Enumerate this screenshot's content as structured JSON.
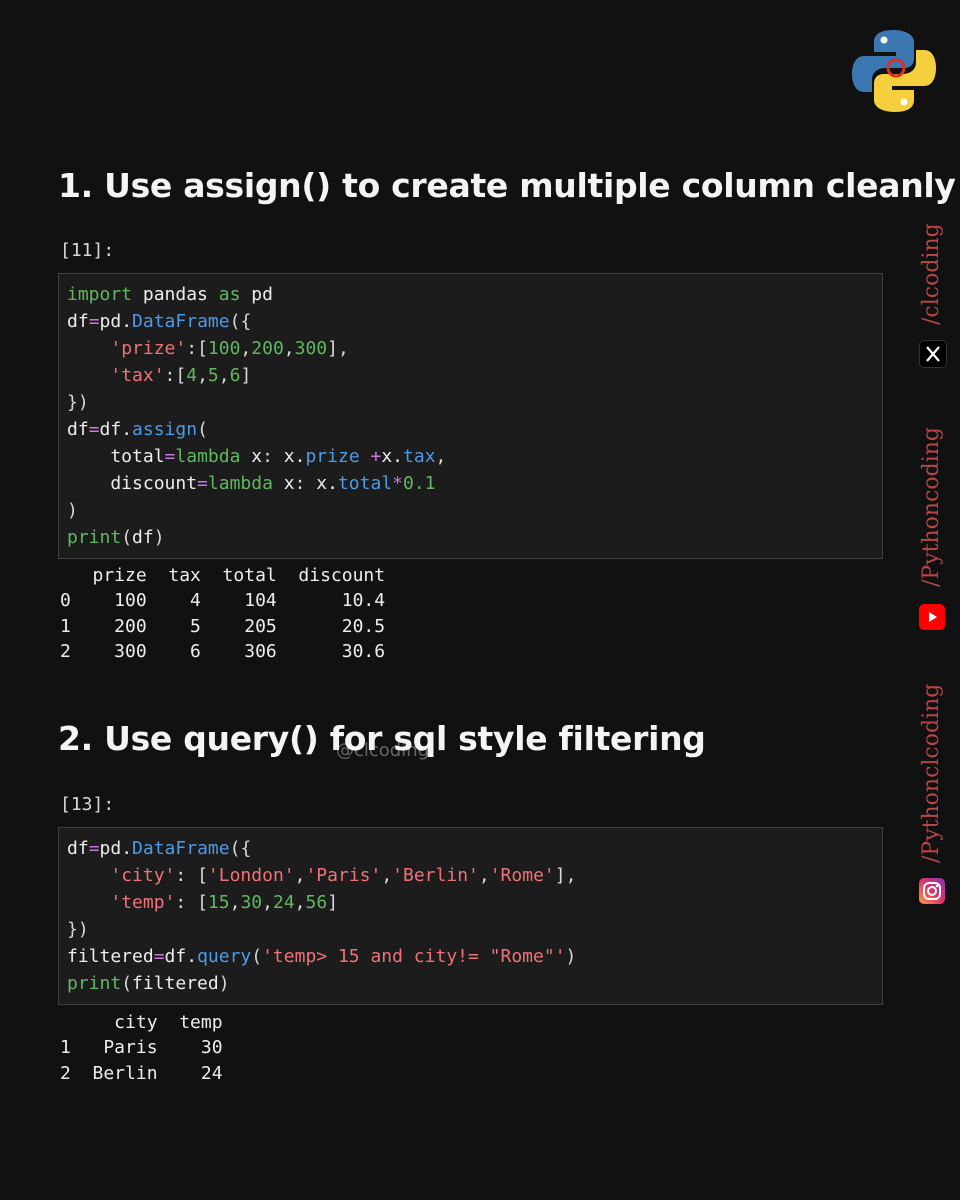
{
  "brand": {
    "logo": "python-logo-icon",
    "watermark": "@clcoding"
  },
  "sections": [
    {
      "heading": "1. Use assign() to create multiple column cleanly",
      "prompt": "[11]:",
      "code_lines": [
        "import pandas as pd",
        "df=pd.DataFrame({",
        "    'prize':[100,200,300],",
        "    'tax':[4,5,6]",
        "})",
        "df=df.assign(",
        "    total=lambda x: x.prize +x.tax,",
        "    discount=lambda x: x.total*0.1",
        ")",
        "print(df)"
      ],
      "output_lines": [
        "   prize  tax  total  discount",
        "0    100    4    104      10.4",
        "1    200    5    205      20.5",
        "2    300    6    306      30.6"
      ]
    },
    {
      "heading": "2. Use query() for sql style filtering",
      "prompt": "[13]:",
      "code_lines": [
        "df=pd.DataFrame({",
        "    'city': ['London','Paris','Berlin','Rome'],",
        "    'temp': [15,30,24,56]",
        "})",
        "filtered=df.query('temp> 15 and city!= \"Rome\"')",
        "print(filtered)"
      ],
      "output_lines": [
        "     city  temp",
        "1   Paris    30",
        "2  Berlin    24"
      ]
    }
  ],
  "social": [
    {
      "handle": "/clcoding",
      "icon": "x-twitter-icon",
      "color": "#b84545"
    },
    {
      "handle": "/Pythoncoding",
      "icon": "youtube-icon",
      "color": "#ff0000"
    },
    {
      "handle": "/Pythonclcoding",
      "icon": "instagram-icon",
      "color": "#d6249f"
    }
  ]
}
